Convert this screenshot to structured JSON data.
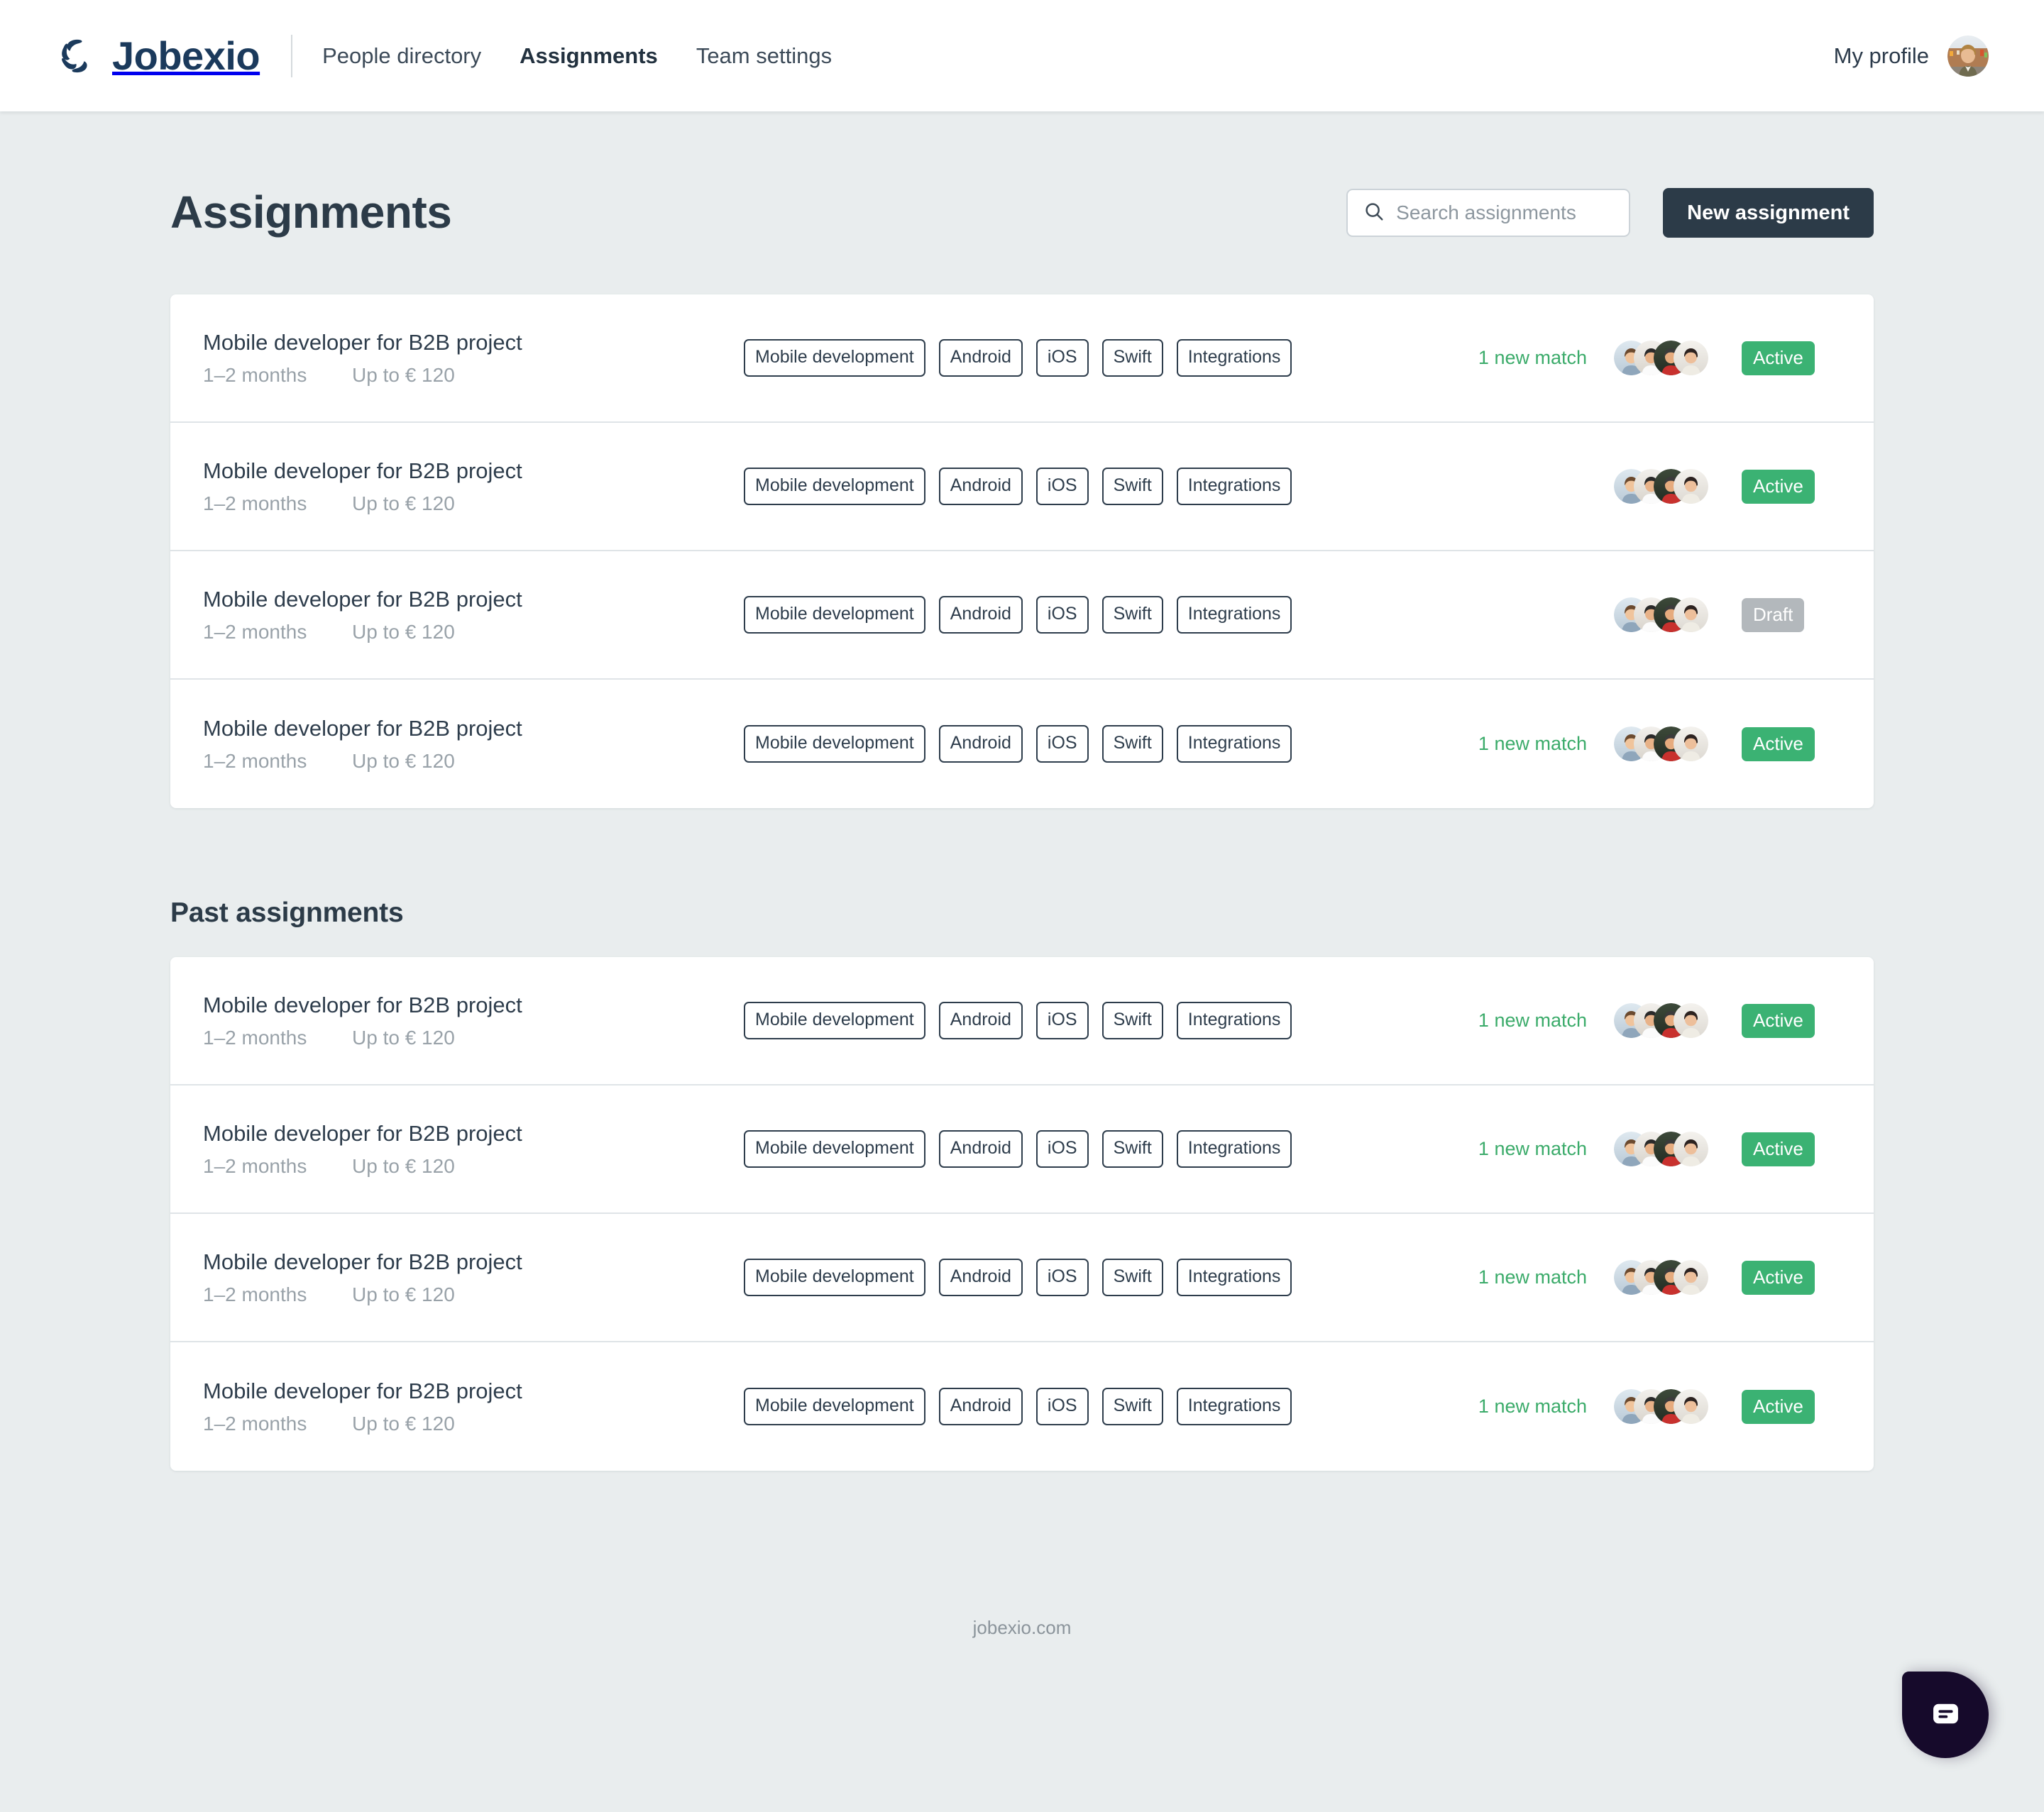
{
  "header": {
    "brand": "Jobexio",
    "brand_icon": "jobexio-spiral-logo",
    "nav": [
      {
        "label": "People directory",
        "active": false
      },
      {
        "label": "Assignments",
        "active": true
      },
      {
        "label": "Team settings",
        "active": false
      }
    ],
    "profile_label": "My profile",
    "avatar_icon": "user-avatar"
  },
  "main": {
    "page_title": "Assignments",
    "search": {
      "placeholder": "Search assignments",
      "value": "",
      "icon": "search-icon"
    },
    "new_assignment_button": "New assignment",
    "past_section_title": "Past assignments",
    "assignments": [
      {
        "title": "Mobile developer for B2B project",
        "duration": "1–2 months",
        "rate": "Up to € 120",
        "tags": [
          "Mobile development",
          "Android",
          "iOS",
          "Swift",
          "Integrations"
        ],
        "match": "1 new match",
        "avatars": 4,
        "status": "Active",
        "status_kind": "active"
      },
      {
        "title": "Mobile developer for B2B project",
        "duration": "1–2 months",
        "rate": "Up to € 120",
        "tags": [
          "Mobile development",
          "Android",
          "iOS",
          "Swift",
          "Integrations"
        ],
        "match": "",
        "avatars": 4,
        "status": "Active",
        "status_kind": "active"
      },
      {
        "title": "Mobile developer for B2B project",
        "duration": "1–2 months",
        "rate": "Up to € 120",
        "tags": [
          "Mobile development",
          "Android",
          "iOS",
          "Swift",
          "Integrations"
        ],
        "match": "",
        "avatars": 4,
        "status": "Draft",
        "status_kind": "draft"
      },
      {
        "title": "Mobile developer for B2B project",
        "duration": "1–2 months",
        "rate": "Up to € 120",
        "tags": [
          "Mobile development",
          "Android",
          "iOS",
          "Swift",
          "Integrations"
        ],
        "match": "1 new match",
        "avatars": 4,
        "status": "Active",
        "status_kind": "active"
      }
    ],
    "past_assignments": [
      {
        "title": "Mobile developer for B2B project",
        "duration": "1–2 months",
        "rate": "Up to € 120",
        "tags": [
          "Mobile development",
          "Android",
          "iOS",
          "Swift",
          "Integrations"
        ],
        "match": "1 new match",
        "avatars": 4,
        "status": "Active",
        "status_kind": "active"
      },
      {
        "title": "Mobile developer for B2B project",
        "duration": "1–2 months",
        "rate": "Up to € 120",
        "tags": [
          "Mobile development",
          "Android",
          "iOS",
          "Swift",
          "Integrations"
        ],
        "match": "1 new match",
        "avatars": 4,
        "status": "Active",
        "status_kind": "active"
      },
      {
        "title": "Mobile developer for B2B project",
        "duration": "1–2 months",
        "rate": "Up to € 120",
        "tags": [
          "Mobile development",
          "Android",
          "iOS",
          "Swift",
          "Integrations"
        ],
        "match": "1 new match",
        "avatars": 4,
        "status": "Active",
        "status_kind": "active"
      },
      {
        "title": "Mobile developer for B2B project",
        "duration": "1–2 months",
        "rate": "Up to € 120",
        "tags": [
          "Mobile development",
          "Android",
          "iOS",
          "Swift",
          "Integrations"
        ],
        "match": "1 new match",
        "avatars": 4,
        "status": "Active",
        "status_kind": "active"
      }
    ]
  },
  "footer": {
    "text": "jobexio.com"
  },
  "chat": {
    "icon": "chat-bubble-icon",
    "label": ""
  },
  "colors": {
    "page_bg": "#e9edee",
    "surface": "#ffffff",
    "text_dark": "#2c3b48",
    "text_muted": "#99a2a9",
    "brand_navy": "#1b3a5c",
    "accent_green": "#3bb273",
    "match_green": "#3bab6a",
    "draft_grey": "#b3b8bc",
    "chat_dark": "#160a2b"
  }
}
